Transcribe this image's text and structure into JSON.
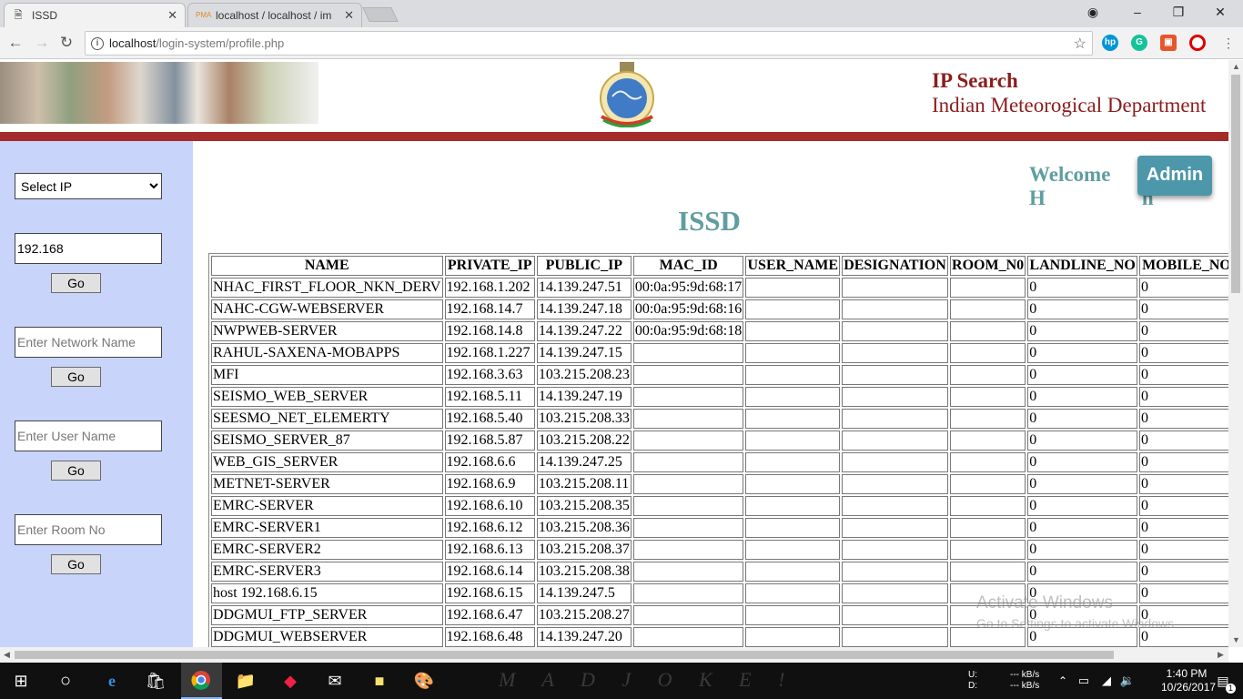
{
  "browser": {
    "tabs": [
      {
        "title": "ISSD",
        "active": true
      },
      {
        "title": "localhost / localhost / im",
        "active": false
      }
    ],
    "address": {
      "host": "localhost",
      "path": "/login-system/profile.php"
    }
  },
  "header": {
    "title": "IP Search",
    "subtitle": "Indian Meteorogical Department"
  },
  "sidebar": {
    "select_label": "Select IP",
    "ip_value": "192.168",
    "network_placeholder": "Enter Network Name",
    "user_placeholder": "Enter User Name",
    "room_placeholder": "Enter Room No",
    "go_label": "Go"
  },
  "main": {
    "welcome": "Welcome H",
    "welcome_tail": "n",
    "admin_label": "Admin",
    "heading": "ISSD"
  },
  "table": {
    "headers": [
      "NAME",
      "PRIVATE_IP",
      "PUBLIC_IP",
      "MAC_ID",
      "USER_NAME",
      "DESIGNATION",
      "ROOM_N0",
      "LANDLINE_NO",
      "MOBILE_NO"
    ],
    "rows": [
      [
        "NHAC_FIRST_FLOOR_NKN_DERV",
        "192.168.1.202",
        "14.139.247.51",
        "00:0a:95:9d:68:17",
        "",
        "",
        "",
        "0",
        "0"
      ],
      [
        "NAHC-CGW-WEBSERVER",
        "192.168.14.7",
        "14.139.247.18",
        "00:0a:95:9d:68:16",
        "",
        "",
        "",
        "0",
        "0"
      ],
      [
        "NWPWEB-SERVER",
        "192.168.14.8",
        "14.139.247.22",
        "00:0a:95:9d:68:18",
        "",
        "",
        "",
        "0",
        "0"
      ],
      [
        "RAHUL-SAXENA-MOBAPPS",
        "192.168.1.227",
        "14.139.247.15",
        "",
        "",
        "",
        "",
        "0",
        "0"
      ],
      [
        "MFI",
        "192.168.3.63",
        "103.215.208.23",
        "",
        "",
        "",
        "",
        "0",
        "0"
      ],
      [
        "SEISMO_WEB_SERVER",
        "192.168.5.11",
        "14.139.247.19",
        "",
        "",
        "",
        "",
        "0",
        "0"
      ],
      [
        "SEESMO_NET_ELEMERTY",
        "192.168.5.40",
        "103.215.208.33",
        "",
        "",
        "",
        "",
        "0",
        "0"
      ],
      [
        "SEISMO_SERVER_87",
        "192.168.5.87",
        "103.215.208.22",
        "",
        "",
        "",
        "",
        "0",
        "0"
      ],
      [
        "WEB_GIS_SERVER",
        "192.168.6.6",
        "14.139.247.25",
        "",
        "",
        "",
        "",
        "0",
        "0"
      ],
      [
        "METNET-SERVER",
        "192.168.6.9",
        "103.215.208.11",
        "",
        "",
        "",
        "",
        "0",
        "0"
      ],
      [
        "EMRC-SERVER",
        "192.168.6.10",
        "103.215.208.35",
        "",
        "",
        "",
        "",
        "0",
        "0"
      ],
      [
        "EMRC-SERVER1",
        "192.168.6.12",
        "103.215.208.36",
        "",
        "",
        "",
        "",
        "0",
        "0"
      ],
      [
        "EMRC-SERVER2",
        "192.168.6.13",
        "103.215.208.37",
        "",
        "",
        "",
        "",
        "0",
        "0"
      ],
      [
        "EMRC-SERVER3",
        "192.168.6.14",
        "103.215.208.38",
        "",
        "",
        "",
        "",
        "0",
        "0"
      ],
      [
        "host 192.168.6.15",
        "192.168.6.15",
        "14.139.247.5",
        "",
        "",
        "",
        "",
        "0",
        "0"
      ],
      [
        "DDGMUI_FTP_SERVER",
        "192.168.6.47",
        "103.215.208.27",
        "",
        "",
        "",
        "",
        "0",
        "0"
      ],
      [
        "DDGMUI_WEBSERVER",
        "192.168.6.48",
        "14.139.247.20",
        "",
        "",
        "",
        "",
        "0",
        "0"
      ]
    ]
  },
  "watermark": {
    "line1": "Activate Windows",
    "line2": "Go to Settings to activate Windows."
  },
  "taskbar": {
    "label": "M A D   J O K E !",
    "net_up": "U:",
    "net_down": "D:",
    "rate_up": "--- kB/s",
    "rate_down": "--- kB/s",
    "time": "1:40 PM",
    "date": "10/26/2017",
    "notif_count": "1"
  },
  "colors": {
    "accent": "#5f9ea0",
    "header_red": "#8b1d1d",
    "bar_red": "#a52a2a",
    "sidebar": "#c8d4fa"
  }
}
